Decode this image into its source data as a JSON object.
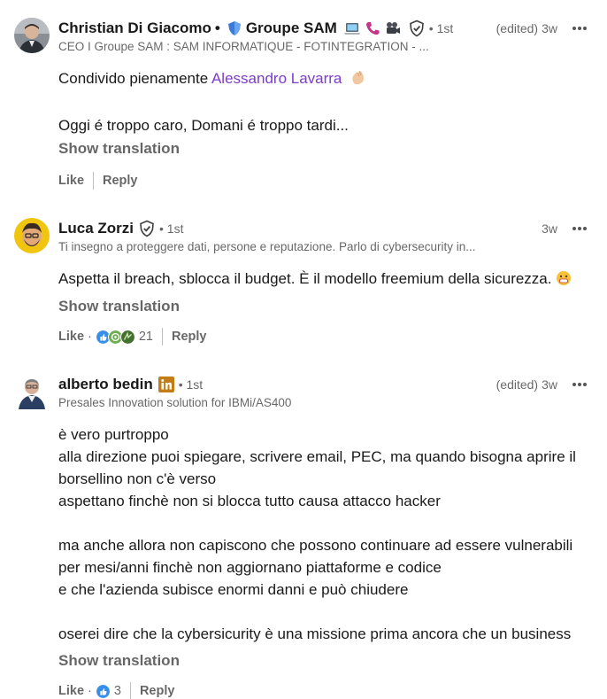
{
  "comments": [
    {
      "author": "Christian Di Giacomo",
      "name_suffix": "Groupe SAM",
      "degree": "• 1st",
      "edited": "(edited)",
      "time": "3w",
      "headline": "CEO I Groupe SAM : SAM INFORMATIQUE - FOTINTEGRATION - ...",
      "body_prefix": "Condivido pienamente",
      "mention": "Alessandro Lavarra",
      "body_line2": "Oggi é troppo caro, Domani é troppo tardi...",
      "show_translation": "Show translation",
      "like": "Like",
      "reply": "Reply"
    },
    {
      "author": "Luca Zorzi",
      "degree": "• 1st",
      "time": "3w",
      "headline": "Ti insegno a proteggere dati, persone e reputazione. Parlo di cybersecurity in...",
      "body": "Aspetta il breach, sblocca il budget. È il modello freemium della sicurezza.",
      "show_translation": "Show translation",
      "like": "Like",
      "reaction_sep": "·",
      "reaction_count": "21",
      "reply": "Reply"
    },
    {
      "author": "alberto bedin",
      "degree": "• 1st",
      "edited": "(edited)",
      "time": "3w",
      "headline": "Presales Innovation solution for IBMi/AS400",
      "lines": [
        "è vero purtroppo",
        "alla direzione puoi spiegare, scrivere email, PEC, ma quando bisogna aprire il",
        "borsellino non c'è verso",
        "aspettano finchè non si blocca tutto causa attacco hacker",
        "",
        "ma anche allora non capiscono che possono continuare ad essere vulnerabili",
        "per mesi/anni finchè non aggiornano piattaforme e codice",
        "e che l'azienda subisce enormi danni e può chiudere",
        "",
        "oserei dire che la cybersicurity è una missione prima ancora che un business"
      ],
      "show_translation": "Show translation",
      "like": "Like",
      "reaction_sep": "·",
      "reaction_count": "3",
      "reply": "Reply"
    }
  ],
  "colors": {
    "mention": "#7c3ccc",
    "like_blue": "#378fe9",
    "celebrate_green": "#44712e",
    "support_purple": "#a872e8",
    "linkedin_gold": "#c37d16"
  },
  "icons": [
    "shield-icon",
    "laptop-icon",
    "phone-icon",
    "video-camera-icon",
    "verified-icon",
    "more-icon",
    "linkedin-premium-icon",
    "clap-emoji-icon",
    "grin-emoji-icon",
    "like-reaction-icon",
    "celebrate-reaction-icon",
    "support-reaction-icon"
  ]
}
